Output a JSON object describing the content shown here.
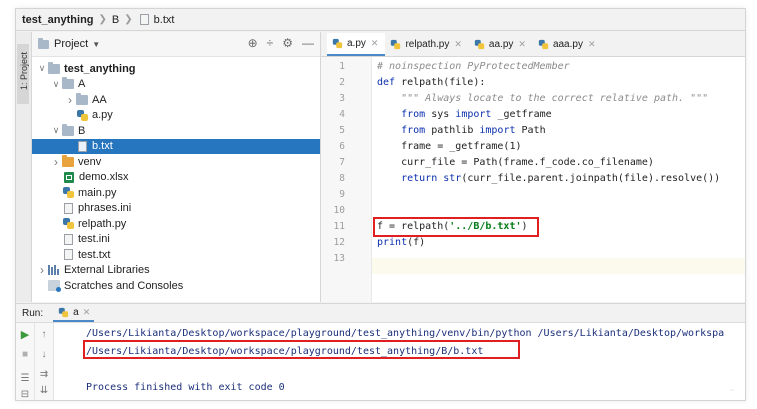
{
  "breadcrumb": {
    "project": "test_anything",
    "folder": "B",
    "file": "b.txt"
  },
  "left_toolstrip": {
    "project_tab": "1: Project"
  },
  "project_panel": {
    "title": "Project",
    "tools": [
      "⊕",
      "÷",
      "⚙",
      "—"
    ],
    "tree": [
      {
        "label": "test_anything",
        "level": 0,
        "expand": "open",
        "icon": "folder-icon",
        "bold": true
      },
      {
        "label": "A",
        "level": 1,
        "expand": "open",
        "icon": "folder-icon"
      },
      {
        "label": "AA",
        "level": 2,
        "expand": "closed",
        "icon": "folder-icon"
      },
      {
        "label": "a.py",
        "level": 2,
        "expand": "none",
        "icon": "python-file-icon"
      },
      {
        "label": "B",
        "level": 1,
        "expand": "open",
        "icon": "folder-icon"
      },
      {
        "label": "b.txt",
        "level": 2,
        "expand": "none",
        "icon": "text-file-icon",
        "selected": true
      },
      {
        "label": "venv",
        "level": 1,
        "expand": "closed",
        "icon": "folder-orange-icon"
      },
      {
        "label": "demo.xlsx",
        "level": 1,
        "expand": "none",
        "icon": "excel-file-icon"
      },
      {
        "label": "main.py",
        "level": 1,
        "expand": "none",
        "icon": "python-file-icon"
      },
      {
        "label": "phrases.ini",
        "level": 1,
        "expand": "none",
        "icon": "text-file-icon"
      },
      {
        "label": "relpath.py",
        "level": 1,
        "expand": "none",
        "icon": "python-file-icon"
      },
      {
        "label": "test.ini",
        "level": 1,
        "expand": "none",
        "icon": "text-file-icon"
      },
      {
        "label": "test.txt",
        "level": 1,
        "expand": "none",
        "icon": "text-file-icon"
      },
      {
        "label": "External Libraries",
        "level": 0,
        "expand": "closed",
        "icon": "library-icon"
      },
      {
        "label": "Scratches and Consoles",
        "level": 0,
        "expand": "none",
        "icon": "scratch-icon"
      }
    ]
  },
  "editor": {
    "tabs": [
      {
        "label": "a.py",
        "active": true
      },
      {
        "label": "relpath.py",
        "active": false
      },
      {
        "label": "aa.py",
        "active": false
      },
      {
        "label": "aaa.py",
        "active": false
      }
    ],
    "line_numbers": [
      "1",
      "2",
      "3",
      "4",
      "5",
      "6",
      "7",
      "8",
      "9",
      "10",
      "11",
      "12",
      "13"
    ],
    "lines": [
      "# noinspection PyProtectedMember",
      "def relpath(file):",
      "    \"\"\" Always locate to the correct relative path. \"\"\"",
      "    from sys import _getframe",
      "    from pathlib import Path",
      "    frame = _getframe(1)",
      "    curr_file = Path(frame.f_code.co_filename)",
      "    return str(curr_file.parent.joinpath(file).resolve())",
      "",
      "",
      "f = relpath('../B/b.txt')",
      "print(f)",
      ""
    ]
  },
  "run_panel": {
    "label": "Run:",
    "config": "a",
    "output": [
      "/Users/Likianta/Desktop/workspace/playground/test_anything/venv/bin/python /Users/Likianta/Desktop/workspa",
      "/Users/Likianta/Desktop/workspace/playground/test_anything/B/b.txt",
      "",
      "Process finished with exit code 0"
    ]
  },
  "colors": {
    "selection": "#2675bf",
    "highlight_box": "#e02020",
    "keyword": "#0b2fae",
    "string": "#067d17",
    "comment": "#8c8c8c"
  }
}
